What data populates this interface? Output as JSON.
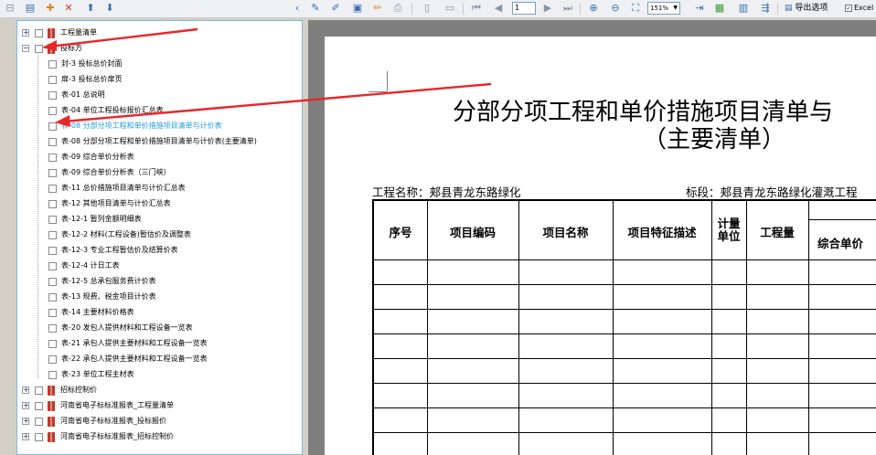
{
  "toolbar": {
    "page_value": "1",
    "zoom_value": "151%",
    "export_label": "导出选项",
    "excel_label": "Excel"
  },
  "tree": {
    "items": [
      {
        "label": "工程量清单",
        "level": 0,
        "expanded": false,
        "book": true
      },
      {
        "label": "投标方",
        "level": 0,
        "expanded": true,
        "book": true
      },
      {
        "label": "封-3 投标总价封面",
        "level": 1
      },
      {
        "label": "扉-3 投标总价扉页",
        "level": 1
      },
      {
        "label": "表-01 总说明",
        "level": 1
      },
      {
        "label": "表-04 单位工程投标报价汇总表",
        "level": 1
      },
      {
        "label": "表-08 分部分项工程和单价措施项目清单与计价表",
        "level": 1,
        "selected": true
      },
      {
        "label": "表-08 分部分项工程和单价措施项目清单与计价表(主要清单)",
        "level": 1
      },
      {
        "label": "表-09 综合单价分析表",
        "level": 1
      },
      {
        "label": "表-09 综合单价分析表（三门峡）",
        "level": 1
      },
      {
        "label": "表-11 总价措施项目清单与计价汇总表",
        "level": 1
      },
      {
        "label": "表-12 其他项目清单与计价汇总表",
        "level": 1
      },
      {
        "label": "表-12-1 暂列金额明细表",
        "level": 1
      },
      {
        "label": "表-12-2 材料(工程设备)暂估价及调整表",
        "level": 1
      },
      {
        "label": "表-12-3 专业工程暂估价及结算价表",
        "level": 1
      },
      {
        "label": "表-12-4 计日工表",
        "level": 1
      },
      {
        "label": "表-12-5 总承包服务费计价表",
        "level": 1
      },
      {
        "label": "表-13 规费、税金项目计价表",
        "level": 1
      },
      {
        "label": "表-14 主要材料价格表",
        "level": 1
      },
      {
        "label": "表-20 发包人提供材料和工程设备一览表",
        "level": 1
      },
      {
        "label": "表-21 承包人提供主要材料和工程设备一览表",
        "level": 1
      },
      {
        "label": "表-22 承包人提供主要材料和工程设备一览表",
        "level": 1
      },
      {
        "label": "表-23 单位工程主材表",
        "level": 1
      },
      {
        "label": "招标控制价",
        "level": 0,
        "expanded": false,
        "book": true
      },
      {
        "label": "河南省电子标标准报表_工程量清单",
        "level": 0,
        "expanded": false,
        "book": true
      },
      {
        "label": "河南省电子标标准报表_投标报价",
        "level": 0,
        "expanded": false,
        "book": true
      },
      {
        "label": "河南省电子标标准报表_招标控制价",
        "level": 0,
        "expanded": false,
        "book": true
      }
    ]
  },
  "document": {
    "title": "分部分项工程和单价措施项目清单与",
    "subtitle": "（主要清单）",
    "project_name": "工程名称：郏县青龙东路绿化",
    "section": "标段：郏县青龙东路绿化灌溉工程",
    "headers": {
      "no": "序号",
      "code": "项目编码",
      "name": "项目名称",
      "desc": "项目特征描述",
      "unit_top": "计量",
      "unit_bottom": "单位",
      "qty": "工程量",
      "unit_price": "综合单价"
    }
  },
  "colors": {
    "selected_text": "#1f9dd9",
    "annotation_arrow": "#e8262a",
    "tree_border": "#7fb8e0"
  }
}
